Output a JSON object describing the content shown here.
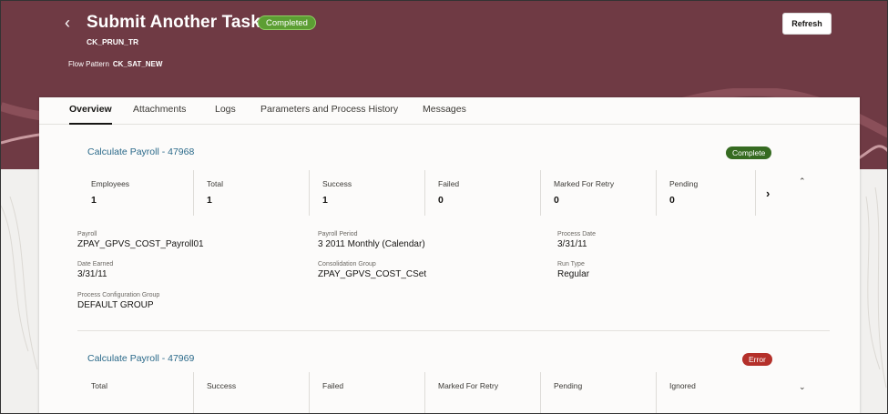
{
  "header": {
    "back_icon": "chevron-left-icon",
    "title": "Submit Another Task",
    "status": "Completed",
    "subtitle": "CK_PRUN_TR",
    "flow_pattern_label": "Flow Pattern",
    "flow_pattern_value": "CK_SAT_NEW",
    "refresh_label": "Refresh"
  },
  "colors": {
    "hero": "#6f3a44",
    "link": "#2b6a8a",
    "completed": "#5c9e33",
    "complete_badge": "#366b21",
    "error_badge": "#b4302a"
  },
  "tabs": [
    {
      "label": "Overview",
      "active": true
    },
    {
      "label": "Attachments"
    },
    {
      "label": "Logs"
    },
    {
      "label": "Parameters and Process History"
    },
    {
      "label": "Messages"
    }
  ],
  "sections": [
    {
      "title": "Calculate Payroll - 47968",
      "badge": "Complete",
      "metrics": [
        {
          "label": "Employees",
          "value": "1"
        },
        {
          "label": "Total",
          "value": "1"
        },
        {
          "label": "Success",
          "value": "1"
        },
        {
          "label": "Failed",
          "value": "0"
        },
        {
          "label": "Marked For Retry",
          "value": "0"
        },
        {
          "label": "Pending",
          "value": "0"
        }
      ],
      "fields": [
        {
          "label": "Payroll",
          "value": "ZPAY_GPVS_COST_Payroll01"
        },
        {
          "label": "Payroll Period",
          "value": "3 2011 Monthly (Calendar)"
        },
        {
          "label": "Process Date",
          "value": "3/31/11"
        },
        {
          "label": "Date Earned",
          "value": "3/31/11"
        },
        {
          "label": "Consolidation Group",
          "value": "ZPAY_GPVS_COST_CSet"
        },
        {
          "label": "Run Type",
          "value": "Regular"
        },
        {
          "label": "Process Configuration Group",
          "value": "DEFAULT GROUP"
        }
      ]
    },
    {
      "title": "Calculate Payroll - 47969",
      "badge": "Error",
      "metrics": [
        {
          "label": "Total"
        },
        {
          "label": "Success"
        },
        {
          "label": "Failed"
        },
        {
          "label": "Marked For Retry"
        },
        {
          "label": "Pending"
        },
        {
          "label": "Ignored"
        }
      ]
    }
  ]
}
